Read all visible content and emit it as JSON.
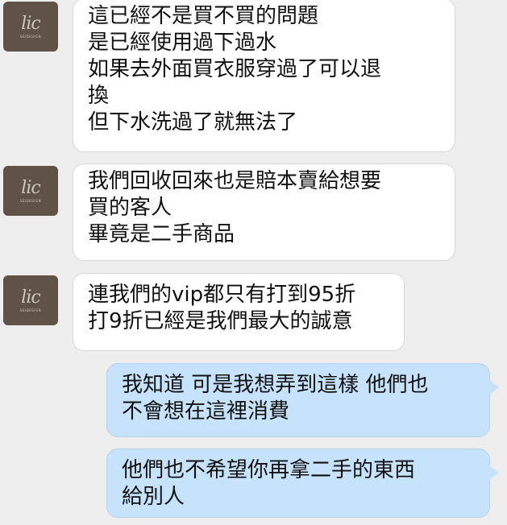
{
  "avatar": {
    "logo_text": "lic",
    "brand_text": "SEIDESIGN"
  },
  "messages": [
    {
      "side": "incoming",
      "lines": [
        "這已經不是買不買的問題",
        "是已經使用過下過水",
        "如果去外面買衣服穿過了可以退",
        "換",
        "但下水洗過了就無法了"
      ]
    },
    {
      "side": "incoming",
      "lines": [
        "我們回收回來也是賠本賣給想要",
        "買的客人",
        "畢竟是二手商品"
      ]
    },
    {
      "side": "incoming",
      "lines": [
        "連我們的vip都只有打到95折",
        "打9折已經是我們最大的誠意"
      ]
    },
    {
      "side": "outgoing",
      "lines": [
        "我知道 可是我想弄到這樣 他們也",
        "不會想在這裡消費"
      ]
    },
    {
      "side": "outgoing",
      "lines": [
        "他們也不希望你再拿二手的東西",
        "給別人"
      ]
    }
  ],
  "colors": {
    "background": "#eeeeee",
    "incoming_bubble": "#ffffff",
    "outgoing_bubble": "#c6e3fb",
    "avatar": "#5f5347"
  }
}
